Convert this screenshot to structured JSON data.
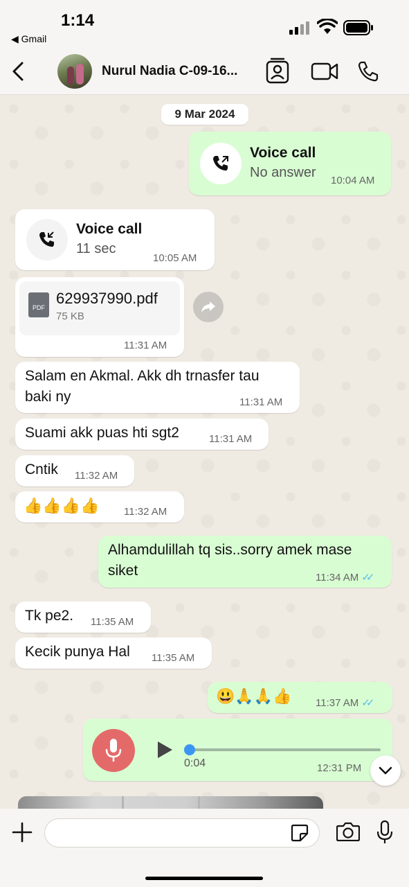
{
  "status_bar": {
    "time": "1:14",
    "back_label": "◀ Gmail"
  },
  "header": {
    "contact_name": "Nurul Nadia C-09-16..."
  },
  "chat": {
    "date": "9 Mar 2024",
    "messages": {
      "call_out": {
        "title": "Voice call",
        "subtitle": "No answer",
        "time": "10:04 AM"
      },
      "call_in": {
        "title": "Voice call",
        "subtitle": "11 sec",
        "time": "10:05 AM"
      },
      "file": {
        "name": "629937990.pdf",
        "size": "75 KB",
        "icon_label": "PDF",
        "time": "11:31 AM"
      },
      "m1": {
        "text1": "Salam en Akmal. Akk dh trnasfer tau",
        "text2": "baki ny",
        "time": "11:31 AM"
      },
      "m2": {
        "text": "Suami akk puas hti sgt2",
        "time": "11:31 AM"
      },
      "m3": {
        "text": "Cntik",
        "time": "11:32 AM"
      },
      "m4": {
        "text": "👍👍👍👍",
        "time": "11:32 AM"
      },
      "m5": {
        "text1": "Alhamdulillah tq sis..sorry amek mase",
        "text2": "siket",
        "time": "11:34 AM"
      },
      "m6": {
        "text": "Tk pe2.",
        "time": "11:35 AM"
      },
      "m7": {
        "text": "Kecik punya Hal",
        "time": "11:35 AM"
      },
      "m8": {
        "text": "😃🙏🙏👍",
        "time": "11:37 AM"
      },
      "voice": {
        "duration": "0:04",
        "time": "12:31 PM",
        "progress": 0
      }
    }
  },
  "colors": {
    "incoming": "#ffffff",
    "outgoing": "#d9fdd3",
    "read_ticks": "#53bdeb",
    "mic": "#e46a6a"
  }
}
